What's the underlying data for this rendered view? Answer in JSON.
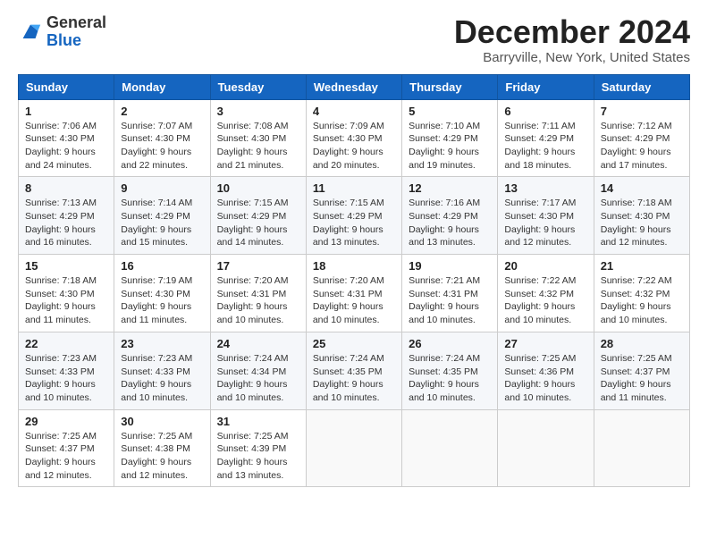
{
  "header": {
    "logo_general": "General",
    "logo_blue": "Blue",
    "title": "December 2024",
    "location": "Barryville, New York, United States"
  },
  "calendar": {
    "days_of_week": [
      "Sunday",
      "Monday",
      "Tuesday",
      "Wednesday",
      "Thursday",
      "Friday",
      "Saturday"
    ],
    "weeks": [
      [
        {
          "day": "1",
          "sunrise": "Sunrise: 7:06 AM",
          "sunset": "Sunset: 4:30 PM",
          "daylight": "Daylight: 9 hours and 24 minutes."
        },
        {
          "day": "2",
          "sunrise": "Sunrise: 7:07 AM",
          "sunset": "Sunset: 4:30 PM",
          "daylight": "Daylight: 9 hours and 22 minutes."
        },
        {
          "day": "3",
          "sunrise": "Sunrise: 7:08 AM",
          "sunset": "Sunset: 4:30 PM",
          "daylight": "Daylight: 9 hours and 21 minutes."
        },
        {
          "day": "4",
          "sunrise": "Sunrise: 7:09 AM",
          "sunset": "Sunset: 4:30 PM",
          "daylight": "Daylight: 9 hours and 20 minutes."
        },
        {
          "day": "5",
          "sunrise": "Sunrise: 7:10 AM",
          "sunset": "Sunset: 4:29 PM",
          "daylight": "Daylight: 9 hours and 19 minutes."
        },
        {
          "day": "6",
          "sunrise": "Sunrise: 7:11 AM",
          "sunset": "Sunset: 4:29 PM",
          "daylight": "Daylight: 9 hours and 18 minutes."
        },
        {
          "day": "7",
          "sunrise": "Sunrise: 7:12 AM",
          "sunset": "Sunset: 4:29 PM",
          "daylight": "Daylight: 9 hours and 17 minutes."
        }
      ],
      [
        {
          "day": "8",
          "sunrise": "Sunrise: 7:13 AM",
          "sunset": "Sunset: 4:29 PM",
          "daylight": "Daylight: 9 hours and 16 minutes."
        },
        {
          "day": "9",
          "sunrise": "Sunrise: 7:14 AM",
          "sunset": "Sunset: 4:29 PM",
          "daylight": "Daylight: 9 hours and 15 minutes."
        },
        {
          "day": "10",
          "sunrise": "Sunrise: 7:15 AM",
          "sunset": "Sunset: 4:29 PM",
          "daylight": "Daylight: 9 hours and 14 minutes."
        },
        {
          "day": "11",
          "sunrise": "Sunrise: 7:15 AM",
          "sunset": "Sunset: 4:29 PM",
          "daylight": "Daylight: 9 hours and 13 minutes."
        },
        {
          "day": "12",
          "sunrise": "Sunrise: 7:16 AM",
          "sunset": "Sunset: 4:29 PM",
          "daylight": "Daylight: 9 hours and 13 minutes."
        },
        {
          "day": "13",
          "sunrise": "Sunrise: 7:17 AM",
          "sunset": "Sunset: 4:30 PM",
          "daylight": "Daylight: 9 hours and 12 minutes."
        },
        {
          "day": "14",
          "sunrise": "Sunrise: 7:18 AM",
          "sunset": "Sunset: 4:30 PM",
          "daylight": "Daylight: 9 hours and 12 minutes."
        }
      ],
      [
        {
          "day": "15",
          "sunrise": "Sunrise: 7:18 AM",
          "sunset": "Sunset: 4:30 PM",
          "daylight": "Daylight: 9 hours and 11 minutes."
        },
        {
          "day": "16",
          "sunrise": "Sunrise: 7:19 AM",
          "sunset": "Sunset: 4:30 PM",
          "daylight": "Daylight: 9 hours and 11 minutes."
        },
        {
          "day": "17",
          "sunrise": "Sunrise: 7:20 AM",
          "sunset": "Sunset: 4:31 PM",
          "daylight": "Daylight: 9 hours and 10 minutes."
        },
        {
          "day": "18",
          "sunrise": "Sunrise: 7:20 AM",
          "sunset": "Sunset: 4:31 PM",
          "daylight": "Daylight: 9 hours and 10 minutes."
        },
        {
          "day": "19",
          "sunrise": "Sunrise: 7:21 AM",
          "sunset": "Sunset: 4:31 PM",
          "daylight": "Daylight: 9 hours and 10 minutes."
        },
        {
          "day": "20",
          "sunrise": "Sunrise: 7:22 AM",
          "sunset": "Sunset: 4:32 PM",
          "daylight": "Daylight: 9 hours and 10 minutes."
        },
        {
          "day": "21",
          "sunrise": "Sunrise: 7:22 AM",
          "sunset": "Sunset: 4:32 PM",
          "daylight": "Daylight: 9 hours and 10 minutes."
        }
      ],
      [
        {
          "day": "22",
          "sunrise": "Sunrise: 7:23 AM",
          "sunset": "Sunset: 4:33 PM",
          "daylight": "Daylight: 9 hours and 10 minutes."
        },
        {
          "day": "23",
          "sunrise": "Sunrise: 7:23 AM",
          "sunset": "Sunset: 4:33 PM",
          "daylight": "Daylight: 9 hours and 10 minutes."
        },
        {
          "day": "24",
          "sunrise": "Sunrise: 7:24 AM",
          "sunset": "Sunset: 4:34 PM",
          "daylight": "Daylight: 9 hours and 10 minutes."
        },
        {
          "day": "25",
          "sunrise": "Sunrise: 7:24 AM",
          "sunset": "Sunset: 4:35 PM",
          "daylight": "Daylight: 9 hours and 10 minutes."
        },
        {
          "day": "26",
          "sunrise": "Sunrise: 7:24 AM",
          "sunset": "Sunset: 4:35 PM",
          "daylight": "Daylight: 9 hours and 10 minutes."
        },
        {
          "day": "27",
          "sunrise": "Sunrise: 7:25 AM",
          "sunset": "Sunset: 4:36 PM",
          "daylight": "Daylight: 9 hours and 10 minutes."
        },
        {
          "day": "28",
          "sunrise": "Sunrise: 7:25 AM",
          "sunset": "Sunset: 4:37 PM",
          "daylight": "Daylight: 9 hours and 11 minutes."
        }
      ],
      [
        {
          "day": "29",
          "sunrise": "Sunrise: 7:25 AM",
          "sunset": "Sunset: 4:37 PM",
          "daylight": "Daylight: 9 hours and 12 minutes."
        },
        {
          "day": "30",
          "sunrise": "Sunrise: 7:25 AM",
          "sunset": "Sunset: 4:38 PM",
          "daylight": "Daylight: 9 hours and 12 minutes."
        },
        {
          "day": "31",
          "sunrise": "Sunrise: 7:25 AM",
          "sunset": "Sunset: 4:39 PM",
          "daylight": "Daylight: 9 hours and 13 minutes."
        },
        null,
        null,
        null,
        null
      ]
    ]
  }
}
